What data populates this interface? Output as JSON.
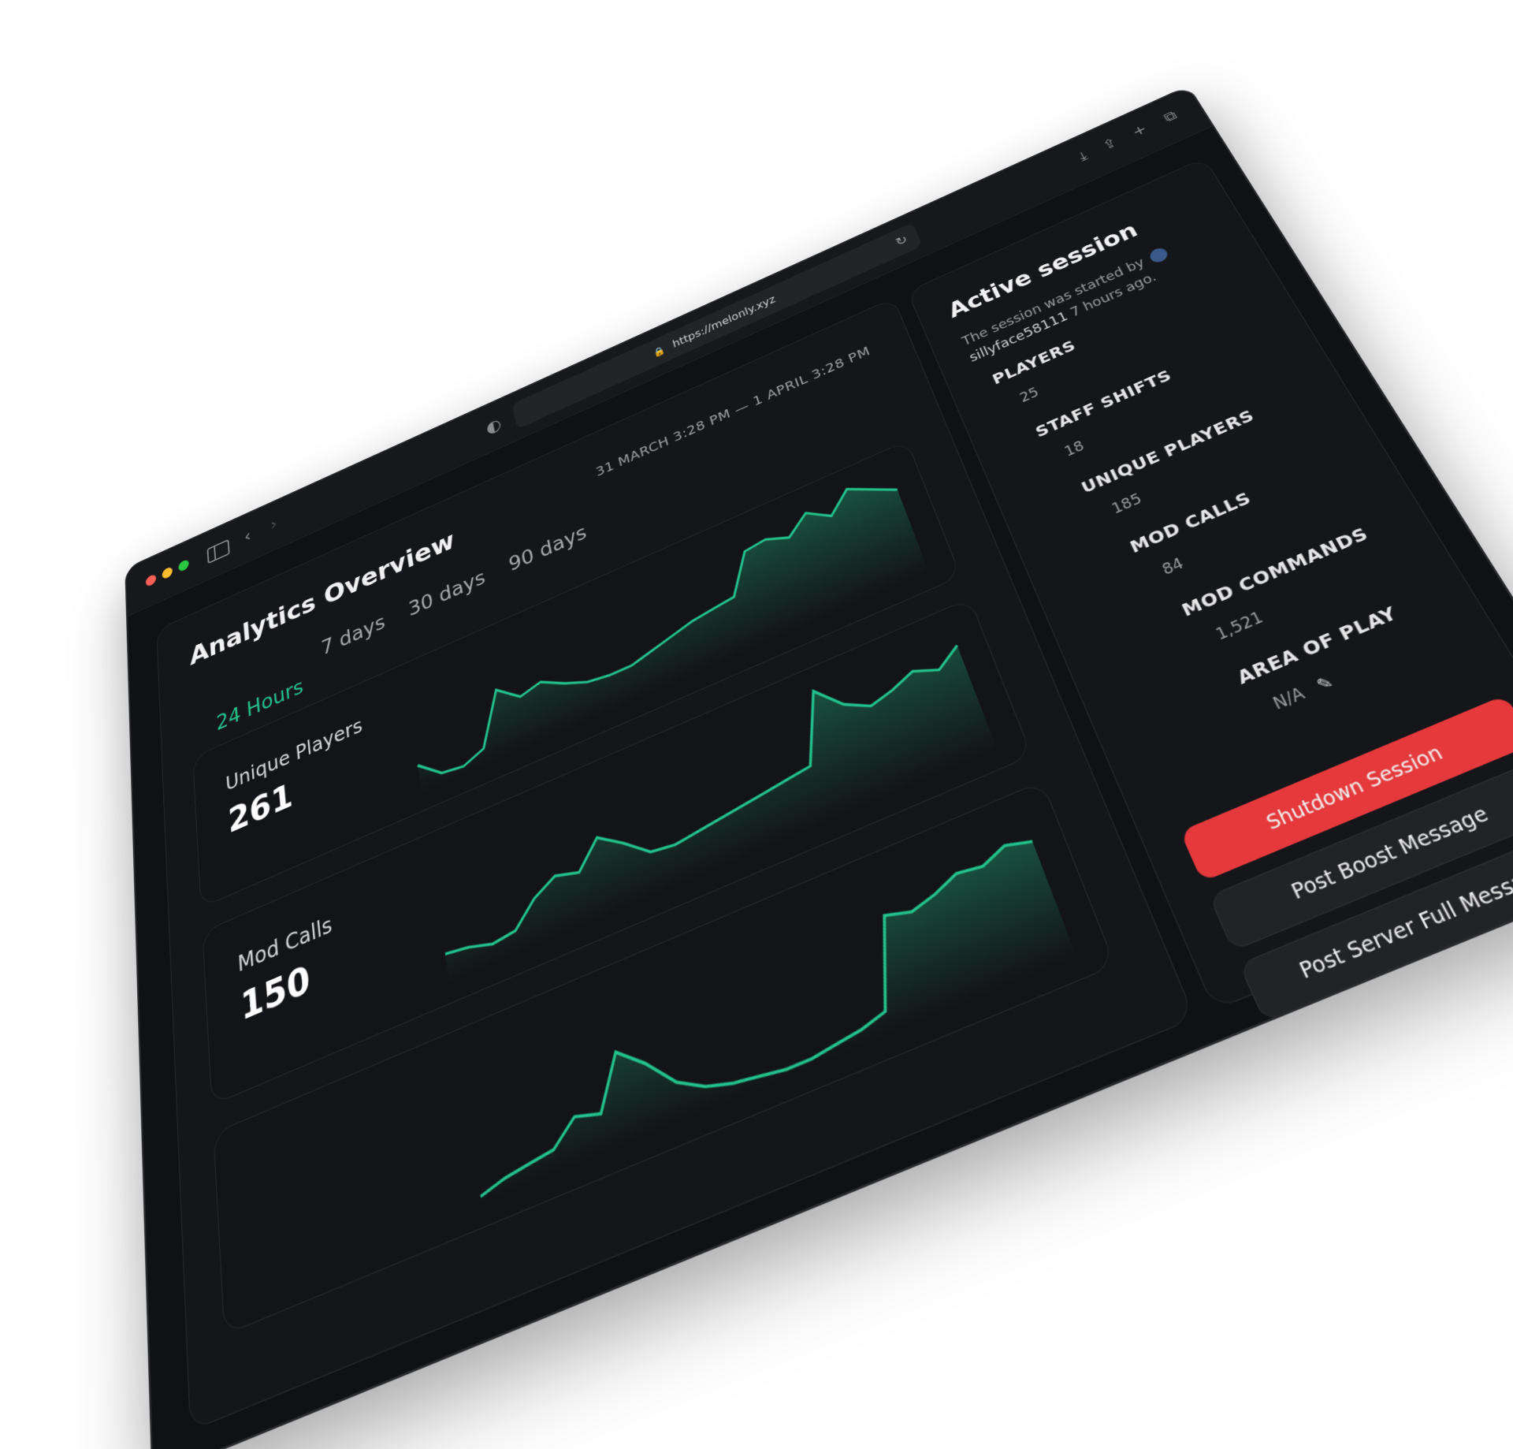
{
  "browser": {
    "url": "https://melonly.xyz"
  },
  "analytics": {
    "title": "Analytics Overview",
    "date_range": "31 MARCH 3:28 PM — 1 APRIL 3:28 PM",
    "tabs": [
      {
        "label": "24 Hours",
        "active": true
      },
      {
        "label": "7 days",
        "active": false
      },
      {
        "label": "30 days",
        "active": false
      },
      {
        "label": "90 days",
        "active": false
      }
    ],
    "cards": [
      {
        "label": "Unique Players",
        "value": "261"
      },
      {
        "label": "Mod Calls",
        "value": "150"
      },
      {
        "label": "",
        "value": ""
      }
    ]
  },
  "session": {
    "title": "Active session",
    "desc_prefix": "The session was started by",
    "user": "sillyface58111",
    "desc_suffix": "7 hours ago.",
    "stats": [
      {
        "label": "PLAYERS",
        "value": "25"
      },
      {
        "label": "STAFF SHIFTS",
        "value": "18"
      },
      {
        "label": "UNIQUE PLAYERS",
        "value": "185"
      },
      {
        "label": "MOD CALLS",
        "value": "84"
      },
      {
        "label": "MOD COMMANDS",
        "value": "1,521"
      },
      {
        "label": "AREA OF PLAY",
        "value": "N/A"
      }
    ],
    "buttons": {
      "shutdown": "Shutdown Session",
      "boost": "Post Boost Message",
      "server_full": "Post Server Full Message"
    }
  },
  "colors": {
    "accent": "#23c58c",
    "danger": "#e5393c",
    "background": "#101113"
  },
  "chart_data": [
    {
      "type": "area",
      "x": [
        1,
        2,
        3,
        4,
        5,
        6,
        7,
        8,
        9,
        10,
        11,
        12,
        13,
        14,
        15,
        16,
        17,
        18,
        19,
        20,
        21,
        22,
        23,
        24
      ],
      "series": [
        {
          "values": [
            10,
            4,
            3,
            6,
            24,
            18,
            20,
            16,
            13,
            12,
            12,
            14,
            16,
            18,
            19,
            20,
            34,
            35,
            32,
            38,
            33,
            40,
            36,
            32
          ]
        }
      ]
    },
    {
      "type": "area",
      "x": [
        1,
        2,
        3,
        4,
        5,
        6,
        7,
        8,
        9,
        10,
        11,
        12,
        13,
        14,
        15,
        16,
        17,
        18,
        19,
        20,
        21,
        22,
        23,
        24
      ],
      "series": [
        {
          "values": [
            9,
            8,
            6,
            7,
            14,
            18,
            16,
            24,
            19,
            13,
            12,
            13,
            14,
            15,
            16,
            17,
            18,
            40,
            32,
            28,
            30,
            33,
            30,
            35
          ]
        }
      ]
    },
    {
      "type": "area",
      "x": [
        1,
        2,
        3,
        4,
        5,
        6,
        7,
        8,
        9,
        10,
        11,
        12,
        13,
        14,
        15,
        16,
        17,
        18,
        19,
        20,
        21,
        22,
        23,
        24
      ],
      "series": [
        {
          "values": [
            2,
            4,
            5,
            6,
            12,
            10,
            24,
            18,
            10,
            6,
            4,
            3,
            2,
            2,
            3,
            4,
            6,
            30,
            28,
            30,
            33,
            32,
            35,
            33
          ]
        }
      ]
    }
  ]
}
